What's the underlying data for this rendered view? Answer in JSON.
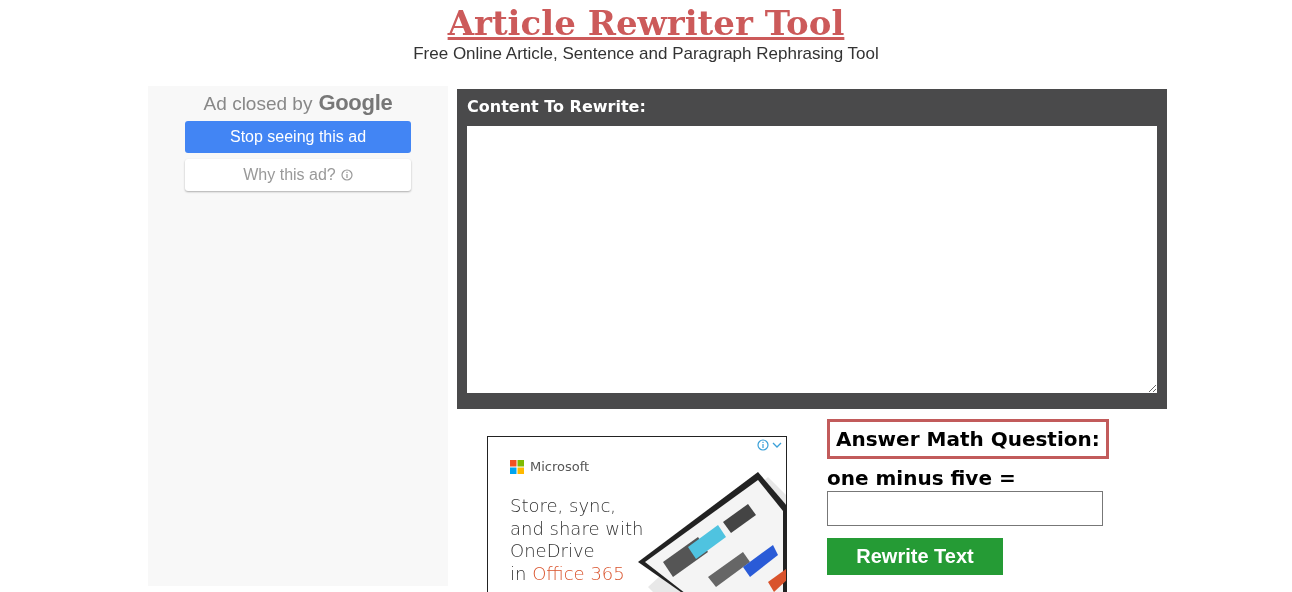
{
  "header": {
    "title": "Article Rewriter Tool",
    "subtitle": "Free Online Article, Sentence and Paragraph Rephrasing Tool"
  },
  "ad_notice": {
    "prefix": "Ad closed by",
    "brand": "Google",
    "buttons": [
      {
        "label": "Stop seeing this ad",
        "kind": "primary"
      },
      {
        "label": "Why this ad?",
        "kind": "secondary"
      }
    ]
  },
  "rewriter": {
    "label": "Content To Rewrite:"
  },
  "ad": {
    "brand": "Microsoft",
    "lines": [
      "Store, sync,",
      "and share with",
      "OneDrive"
    ],
    "last_prefix": "in",
    "last_highlight": "Office 365"
  },
  "math": {
    "heading": "Answer Math Question:",
    "question": "one minus five =",
    "button": "Rewrite Text"
  }
}
